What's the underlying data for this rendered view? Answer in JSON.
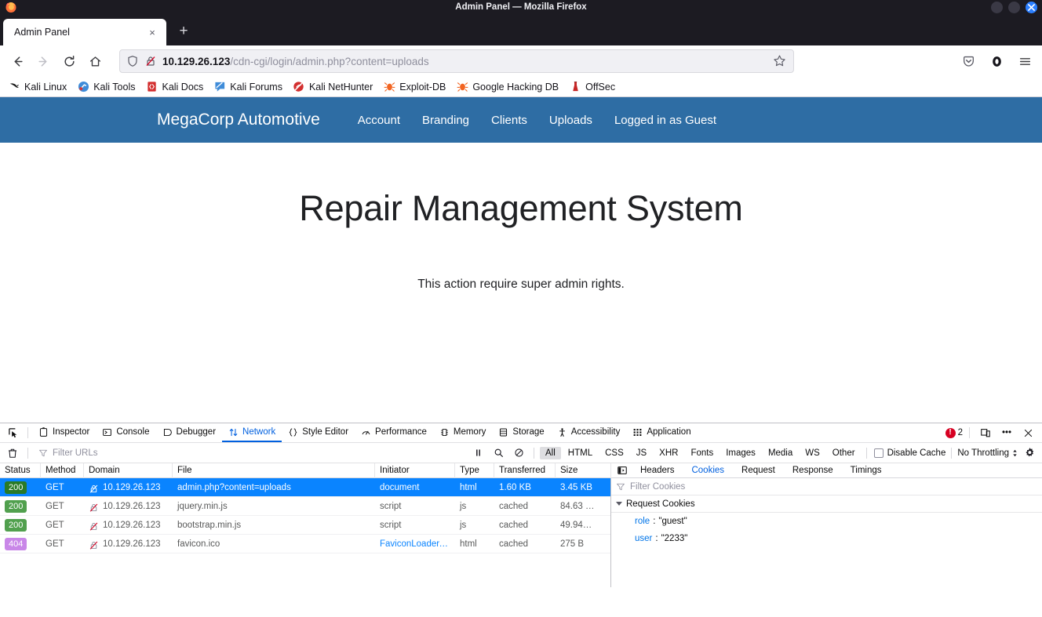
{
  "window": {
    "title": "Admin Panel — Mozilla Firefox",
    "controls": {
      "minimize": "minimize",
      "maximize": "maximize",
      "close": "×"
    }
  },
  "tabs": {
    "items": [
      {
        "title": "Admin Panel",
        "close": "×"
      }
    ],
    "new_tab": "+"
  },
  "toolbar": {
    "back": "←",
    "forward": "→",
    "reload": "⟳",
    "home": "⌂",
    "url_host": "10.129.26.123",
    "url_path": "/cdn-cgi/login/admin.php?content=uploads",
    "url_full": "10.129.26.123/cdn-cgi/login/admin.php?content=uploads",
    "bookmark_star": "☆",
    "pocket": "pocket",
    "account": "account",
    "menu": "≡"
  },
  "bookmarks": [
    {
      "label": "Kali Linux",
      "icon": "kali-dragon-icon"
    },
    {
      "label": "Kali Tools",
      "icon": "kali-tools-icon"
    },
    {
      "label": "Kali Docs",
      "icon": "kali-docs-icon"
    },
    {
      "label": "Kali Forums",
      "icon": "kali-forums-icon"
    },
    {
      "label": "Kali NetHunter",
      "icon": "kali-nethunter-icon"
    },
    {
      "label": "Exploit-DB",
      "icon": "exploitdb-icon"
    },
    {
      "label": "Google Hacking DB",
      "icon": "ghdb-icon"
    },
    {
      "label": "OffSec",
      "icon": "offsec-icon"
    }
  ],
  "page": {
    "nav": {
      "brand": "MegaCorp Automotive",
      "bg_color": "#2e6da4",
      "links": [
        {
          "label": "Account"
        },
        {
          "label": "Branding"
        },
        {
          "label": "Clients"
        },
        {
          "label": "Uploads"
        },
        {
          "label": "Logged in as Guest"
        }
      ]
    },
    "heading": "Repair Management System",
    "message": "This action require super admin rights."
  },
  "devtools": {
    "picker": "element-picker",
    "tabs": [
      {
        "label": "Inspector",
        "icon": "inspector-icon",
        "active": false
      },
      {
        "label": "Console",
        "icon": "console-icon",
        "active": false
      },
      {
        "label": "Debugger",
        "icon": "debugger-icon",
        "active": false
      },
      {
        "label": "Network",
        "icon": "network-icon",
        "active": true
      },
      {
        "label": "Style Editor",
        "icon": "style-editor-icon",
        "active": false
      },
      {
        "label": "Performance",
        "icon": "performance-icon",
        "active": false
      },
      {
        "label": "Memory",
        "icon": "memory-icon",
        "active": false
      },
      {
        "label": "Storage",
        "icon": "storage-icon",
        "active": false
      },
      {
        "label": "Accessibility",
        "icon": "accessibility-icon",
        "active": false
      },
      {
        "label": "Application",
        "icon": "application-icon",
        "active": false
      }
    ],
    "error_count": "2",
    "responsive_mode": "responsive-design-mode",
    "more_tools": "•••",
    "close": "✕",
    "network_toolbar": {
      "clear": "trash-icon",
      "filter_placeholder": "Filter URLs",
      "pause": "pause-icon",
      "search": "search-icon",
      "block": "block-icon",
      "filters": [
        {
          "label": "All",
          "active": true
        },
        {
          "label": "HTML",
          "active": false
        },
        {
          "label": "CSS",
          "active": false
        },
        {
          "label": "JS",
          "active": false
        },
        {
          "label": "XHR",
          "active": false
        },
        {
          "label": "Fonts",
          "active": false
        },
        {
          "label": "Images",
          "active": false
        },
        {
          "label": "Media",
          "active": false
        },
        {
          "label": "WS",
          "active": false
        },
        {
          "label": "Other",
          "active": false
        }
      ],
      "disable_cache_label": "Disable Cache",
      "disable_cache_checked": false,
      "throttling": "No Throttling",
      "settings": "gear-icon"
    },
    "table": {
      "columns": [
        "Status",
        "Method",
        "Domain",
        "File",
        "Initiator",
        "Type",
        "Transferred",
        "Size"
      ],
      "rows": [
        {
          "status": "200",
          "status_kind": "ok",
          "method": "GET",
          "domain": "10.129.26.123",
          "file": "admin.php?content=uploads",
          "initiator": "document",
          "initiator_link": false,
          "type": "html",
          "transferred": "1.60 KB",
          "size": "3.45 KB",
          "selected": true
        },
        {
          "status": "200",
          "status_kind": "ok",
          "method": "GET",
          "domain": "10.129.26.123",
          "file": "jquery.min.js",
          "initiator": "script",
          "initiator_link": false,
          "type": "js",
          "transferred": "cached",
          "size": "84.63 …",
          "selected": false
        },
        {
          "status": "200",
          "status_kind": "ok",
          "method": "GET",
          "domain": "10.129.26.123",
          "file": "bootstrap.min.js",
          "initiator": "script",
          "initiator_link": false,
          "type": "js",
          "transferred": "cached",
          "size": "49.94…",
          "selected": false
        },
        {
          "status": "404",
          "status_kind": "err",
          "method": "GET",
          "domain": "10.129.26.123",
          "file": "favicon.ico",
          "initiator": "FaviconLoader.js…",
          "initiator_link": true,
          "type": "html",
          "transferred": "cached",
          "size": "275 B",
          "selected": false
        }
      ]
    },
    "detail": {
      "pane_toggle": "toggle-pane-icon",
      "tabs": [
        {
          "label": "Headers",
          "active": false
        },
        {
          "label": "Cookies",
          "active": true
        },
        {
          "label": "Request",
          "active": false
        },
        {
          "label": "Response",
          "active": false
        },
        {
          "label": "Timings",
          "active": false
        }
      ],
      "filter_placeholder": "Filter Cookies",
      "group_label": "Request Cookies",
      "cookies": [
        {
          "name": "role",
          "value": "\"guest\""
        },
        {
          "name": "user",
          "value": "\"2233\""
        }
      ]
    }
  },
  "colors": {
    "nav_blue": "#2e6da4",
    "selected_row": "#0a84ff",
    "status_ok": "#51a04e",
    "status_err": "#c987e8",
    "devtools_accent": "#0060df",
    "error_red": "#d70022"
  }
}
